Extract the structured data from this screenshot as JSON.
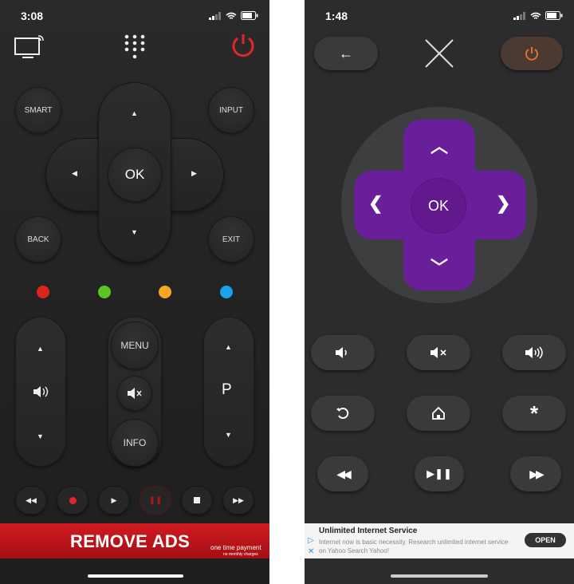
{
  "left": {
    "time": "3:08",
    "smart": "SMART",
    "input": "INPUT",
    "ok": "OK",
    "back": "BACK",
    "exit": "EXIT",
    "menu": "MENU",
    "info": "INFO",
    "p": "P",
    "ad_title": "REMOVE ADS",
    "ad_sub": "one time payment",
    "ad_sub2": "no monthly charges",
    "colors": {
      "red": "#d9261c",
      "green": "#5cc41f",
      "yellow": "#f5a623",
      "blue": "#1aa3e8",
      "power": "#e0262a",
      "banner": "#c4151b"
    }
  },
  "right": {
    "time": "1:48",
    "ok": "OK",
    "ad_title": "Unlimited Internet Service",
    "ad_body": "Internet now is basic necessity. Research unlimited internet service on Yahoo Search Yahoo!",
    "open": "OPEN",
    "colors": {
      "purple": "#6a1f9a",
      "power": "#e07030"
    }
  }
}
